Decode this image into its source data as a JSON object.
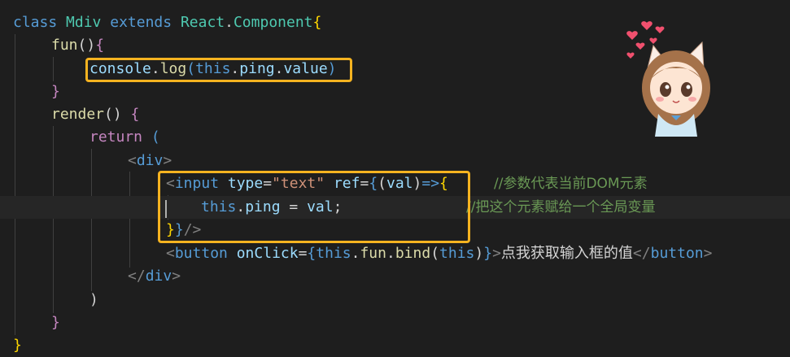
{
  "code": {
    "l1": {
      "kw_class": "class",
      "name": "Mdiv",
      "kw_extends": "extends",
      "base_obj": "React",
      "dot": ".",
      "base_cls": "Component",
      "brace": "{"
    },
    "l2": {
      "fn": "fun",
      "parens": "()",
      "brace": "{"
    },
    "l3": {
      "obj": "console",
      "dot1": ".",
      "method": "log",
      "open": "(",
      "this": "this",
      "dot2": ".",
      "prop1": "ping",
      "dot3": ".",
      "prop2": "value",
      "close": ")"
    },
    "l4": {
      "brace": "}"
    },
    "l5": {
      "fn": "render",
      "parens": "()",
      "brace": " {"
    },
    "l6": {
      "kw": "return",
      "paren": " ("
    },
    "l7": {
      "lt": "<",
      "tag": "div",
      "gt": ">"
    },
    "l8": {
      "lt": "<",
      "tag": "input",
      "attr1": "type",
      "eq1": "=",
      "val1": "\"text\"",
      "attr2": "ref",
      "eq2": "=",
      "ob": "{",
      "p1": "(",
      "param": "val",
      "p2": ")",
      "arrow": "=>",
      "brace": "{",
      "comment": "//参数代表当前DOM元素"
    },
    "l9": {
      "this": "this",
      "dot": ".",
      "prop": "ping",
      "op": " = ",
      "val": "val",
      "semi": ";",
      "comment": "//把这个元素赋给一个全局变量"
    },
    "l10": {
      "brace1": "}",
      "brace2": "}",
      "close": "/>"
    },
    "l11": {
      "lt": "<",
      "tag": "button",
      "attr": "onClick",
      "eq": "=",
      "ob": "{",
      "this1": "this",
      "dot1": ".",
      "fn": "fun",
      "dot2": ".",
      "bind": "bind",
      "p1": "(",
      "this2": "this",
      "p2": ")",
      "cb": "}",
      "gt": ">",
      "text": "点我获取输入框的值",
      "closelt": "</",
      "closetag": "button",
      "closegt": ">"
    },
    "l12": {
      "lt": "</",
      "tag": "div",
      "gt": ">"
    },
    "l13": {
      "paren": ")"
    },
    "l14": {
      "brace": "}"
    },
    "l15": {
      "brace": "}"
    }
  },
  "colors": {
    "background": "#1e1e1e",
    "highlight_border": "#f5b320"
  }
}
